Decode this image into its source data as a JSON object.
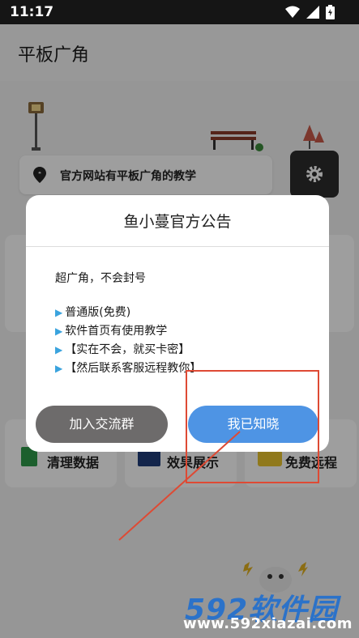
{
  "status_bar": {
    "time": "11:17"
  },
  "app": {
    "title": "平板广角"
  },
  "background": {
    "notice_text": "官方网站有平板广角的教学",
    "cards": [
      "清理数据",
      "效果展示",
      "免费远程"
    ]
  },
  "dialog": {
    "title": "鱼小蔓官方公告",
    "lines": [
      "超广角，不会封号"
    ],
    "bullets": [
      "普通版(免费)",
      "软件首页有使用教学",
      "【实在不会，就买卡密】",
      "【然后联系客服远程教你】"
    ],
    "buttons": {
      "join": "加入交流群",
      "ok": "我已知晓"
    }
  },
  "watermark": {
    "logo": "592软件园",
    "url": "www.592xiazai.com"
  },
  "colors": {
    "primary_button": "#4e94e4",
    "secondary_button": "#6d6b6b",
    "annotation": "#de4a34"
  }
}
